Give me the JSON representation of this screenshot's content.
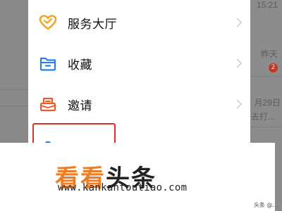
{
  "menu": {
    "items": [
      {
        "label": "服务大厅",
        "icon": "heart-icon",
        "color": "#F5A623"
      },
      {
        "label": "收藏",
        "icon": "folder-icon",
        "color": "#2B7DE9"
      },
      {
        "label": "邀请",
        "icon": "invite-box-icon",
        "color": "#F05A28"
      }
    ]
  },
  "background": {
    "time_top": "15:21",
    "yesterday": "昨天",
    "badge": "2",
    "date": "月29日",
    "preview": "去打..."
  },
  "watermark": {
    "kan": "看看",
    "toutiao": "头条",
    "url": "www.kankantoutiao.com"
  },
  "corner_tag": "头条 @..."
}
